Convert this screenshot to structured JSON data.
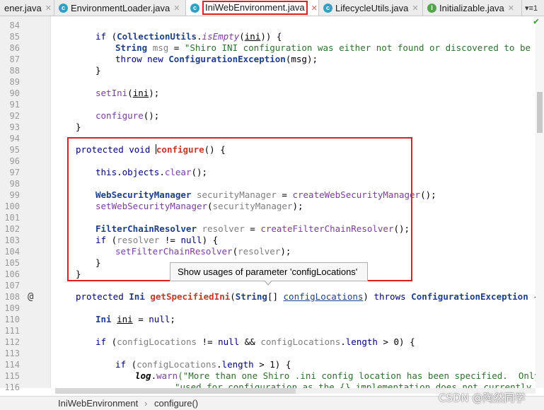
{
  "tabs": [
    {
      "label": "ener.java",
      "icon": "class-icon",
      "active": false
    },
    {
      "label": "EnvironmentLoader.java",
      "icon": "class-icon",
      "active": false
    },
    {
      "label": "IniWebEnvironment.java",
      "icon": "class-icon",
      "active": true
    },
    {
      "label": "LifecycleUtils.java",
      "icon": "class-icon",
      "active": false
    },
    {
      "label": "Initializable.java",
      "icon": "interface-icon",
      "active": false
    }
  ],
  "tab_menu_label": "▾≡1",
  "line_numbers": [
    "84",
    "85",
    "86",
    "87",
    "88",
    "89",
    "90",
    "91",
    "92",
    "93",
    "94",
    "95",
    "96",
    "97",
    "98",
    "99",
    "100",
    "101",
    "102",
    "103",
    "104",
    "105",
    "106",
    "107",
    "108",
    "109",
    "110",
    "111",
    "112",
    "113",
    "114",
    "115",
    "116"
  ],
  "code": {
    "l85": {
      "kw_if": "if",
      "cls": "CollectionUtils",
      "dot": ".",
      "method": "isEmpty",
      "open": "(",
      "var": "ini",
      "close": ")) {"
    },
    "l86": {
      "type": "String",
      "var": "msg",
      "eq": " = ",
      "str": "\"Shiro INI configuration was either not found or discovered to be empty/un"
    },
    "l87": {
      "kw": "throw new ",
      "type": "ConfigurationException",
      "rest": "(msg);"
    },
    "l88": "}",
    "l90": {
      "method": "setIni",
      "open": "(",
      "var": "ini",
      "close": ");"
    },
    "l92": {
      "method": "configure",
      "rest": "();"
    },
    "l93": "}",
    "l95": {
      "kw": "protected void ",
      "method": "configure",
      "rest": "() {"
    },
    "l97": {
      "kw": "this",
      "dot": ".",
      "field": "objects",
      "dot2": ".",
      "method": "clear",
      "rest": "();"
    },
    "l99": {
      "type": "WebSecurityManager",
      "var": "securityManager",
      "eq": " = ",
      "method": "createWebSecurityManager",
      "rest": "();"
    },
    "l100": {
      "method": "setWebSecurityManager",
      "open": "(",
      "param": "securityManager",
      "close": ");"
    },
    "l102": {
      "type": "FilterChainResolver",
      "var": "resolver",
      "eq": " = ",
      "method": "createFilterChainResolver",
      "rest": "();"
    },
    "l103": {
      "kw_if": "if",
      "open": " (",
      "param": "resolver",
      "mid": " != ",
      "kw_null": "null",
      "close": ") {"
    },
    "l104": {
      "method": "setFilterChainResolver",
      "open": "(",
      "param": "resolver",
      "close": ");"
    },
    "l105": "}",
    "l106": "}",
    "l108": {
      "kw": "protected ",
      "type": "Ini",
      "method": "getSpecifiedIni",
      "open": "(",
      "ptype": "String",
      "arr": "[] ",
      "param": "configLocations",
      "close": ") ",
      "kw_throws": "throws ",
      "exc": "ConfigurationException",
      "end": " {"
    },
    "l110": {
      "type": "Ini",
      "var": "ini",
      "eq": " = ",
      "kw_null": "null",
      "end": ";"
    },
    "l112": {
      "kw_if": "if",
      "open": " (",
      "param": "configLocations",
      "mid": " != ",
      "kw_null": "null",
      "and": " && ",
      "param2": "configLocations",
      "dot": ".",
      "field": "length",
      "tail": " > 0) {"
    },
    "l114": {
      "kw_if": "if",
      "open": " (",
      "param": "configLocations",
      "dot": ".",
      "field": "length",
      "tail": " > 1) {"
    },
    "l115": {
      "log": "log",
      "dot": ".",
      "method": "warn",
      "str": "(\"More than one Shiro .ini config location has been specified.  Only the fi"
    },
    "l116": {
      "str": "\"used for configuration as the {} implementation does not currently support"
    }
  },
  "tooltip": "Show usages of parameter 'configLocations'",
  "breadcrumb": [
    "IniWebEnvironment",
    "configure()"
  ],
  "watermark": "CSDN @陶然同学",
  "gutter_marker": "@",
  "colors": {
    "highlight_border": "#e02020",
    "keyword": "#000080",
    "method": "#7a3e9d",
    "string": "#2f6f2f"
  }
}
